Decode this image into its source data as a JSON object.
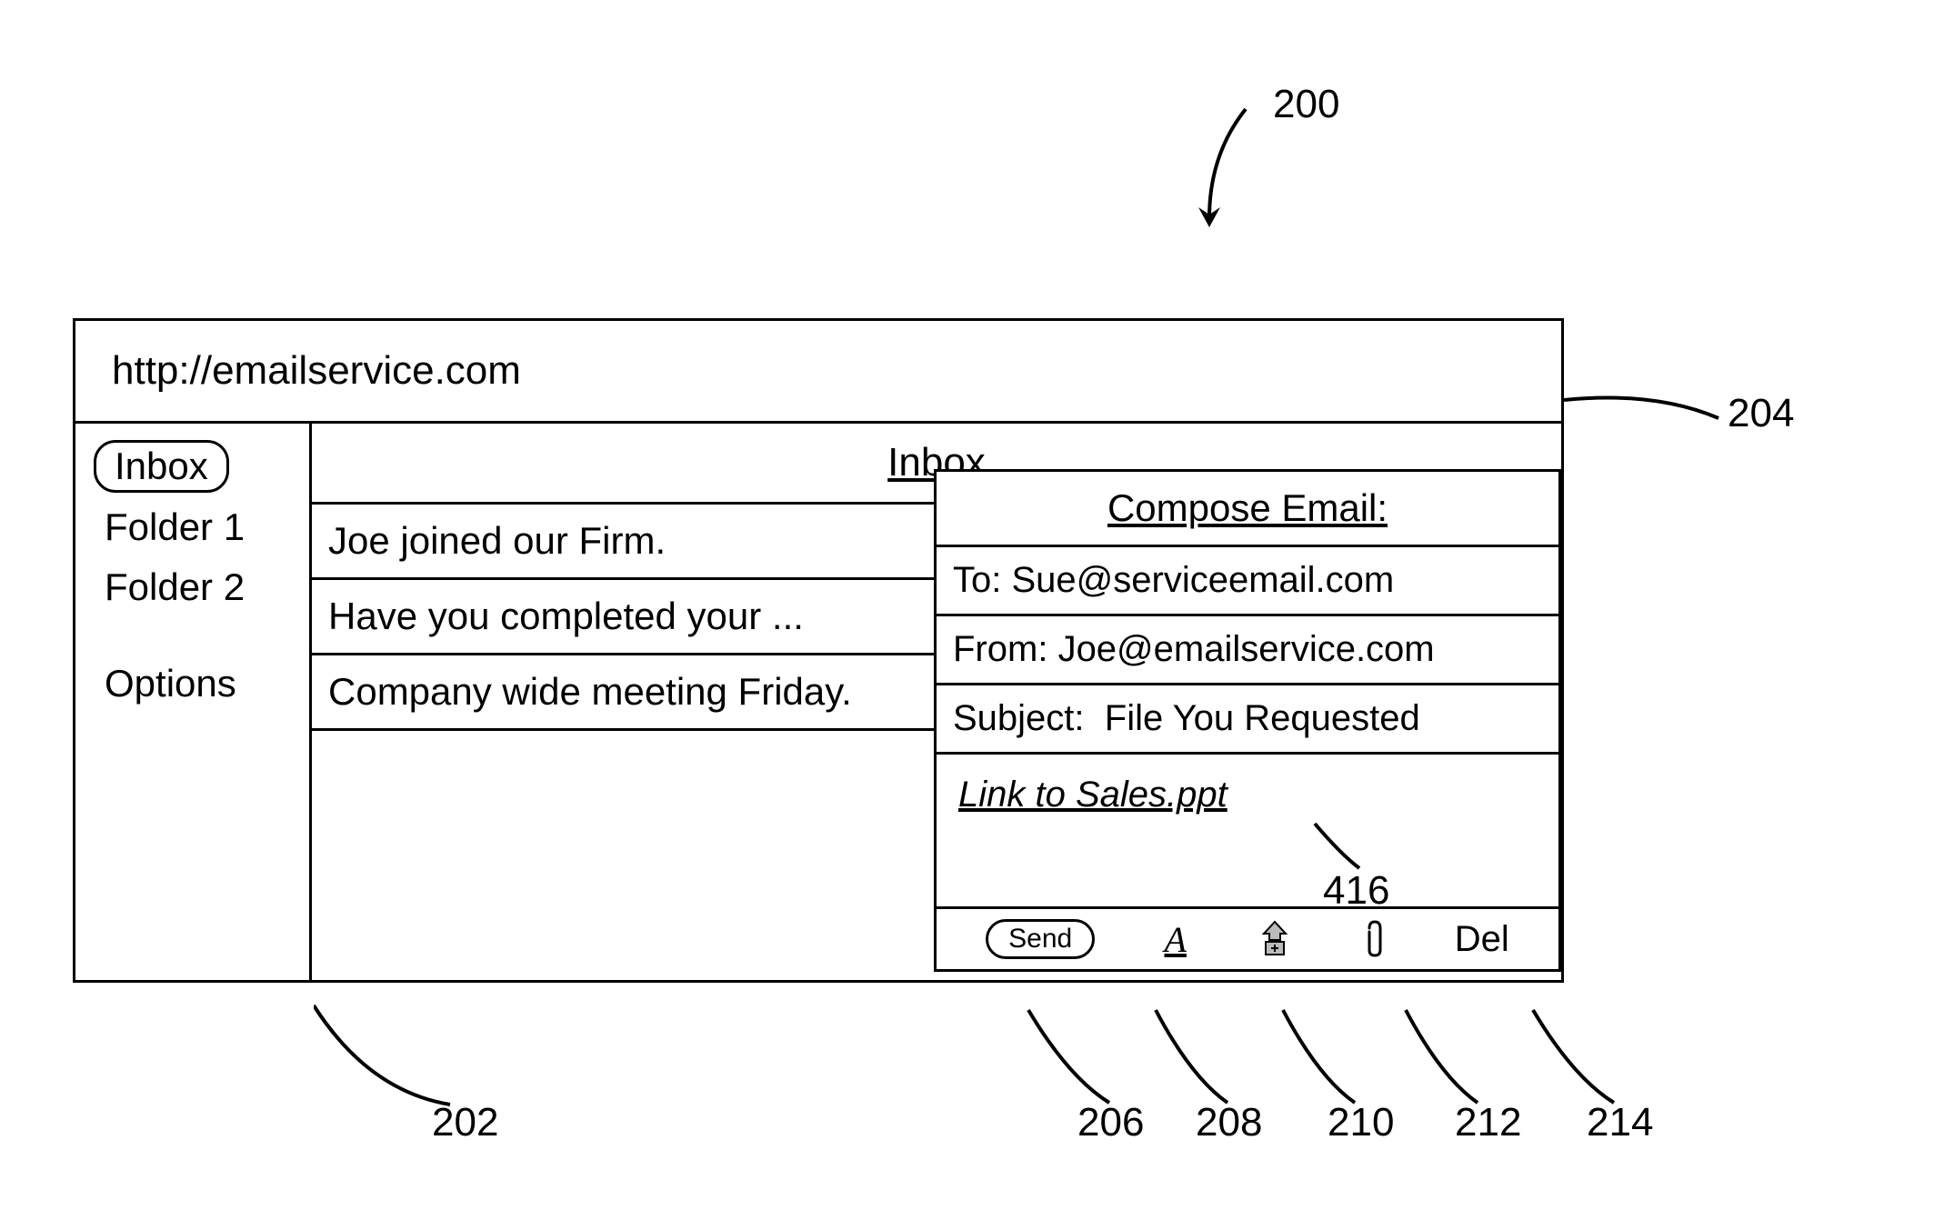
{
  "callouts": {
    "c200": "200",
    "c204": "204",
    "c202": "202",
    "c416": "416",
    "c206": "206",
    "c208": "208",
    "c210": "210",
    "c212": "212",
    "c214": "214"
  },
  "addressbar": {
    "url": "http://emailservice.com"
  },
  "sidebar": {
    "items": [
      {
        "label": "Inbox",
        "selected": true
      },
      {
        "label": "Folder 1",
        "selected": false
      },
      {
        "label": "Folder 2",
        "selected": false
      }
    ],
    "options_label": "Options"
  },
  "msglist": {
    "header": "Inbox",
    "rows": [
      {
        "text": "Joe joined our Firm."
      },
      {
        "text": "Have you completed your ..."
      },
      {
        "text": "Company wide meeting Friday."
      }
    ]
  },
  "compose": {
    "title": "Compose Email:",
    "to_label": "To:",
    "to_value": "Sue@serviceemail.com",
    "from_label": "From:",
    "from_value": "Joe@emailservice.com",
    "subject_label": "Subject:",
    "subject_value": "File You Requested",
    "body_link": "Link to Sales.ppt",
    "toolbar": {
      "send": "Send",
      "format": "A",
      "delete": "Del"
    }
  }
}
